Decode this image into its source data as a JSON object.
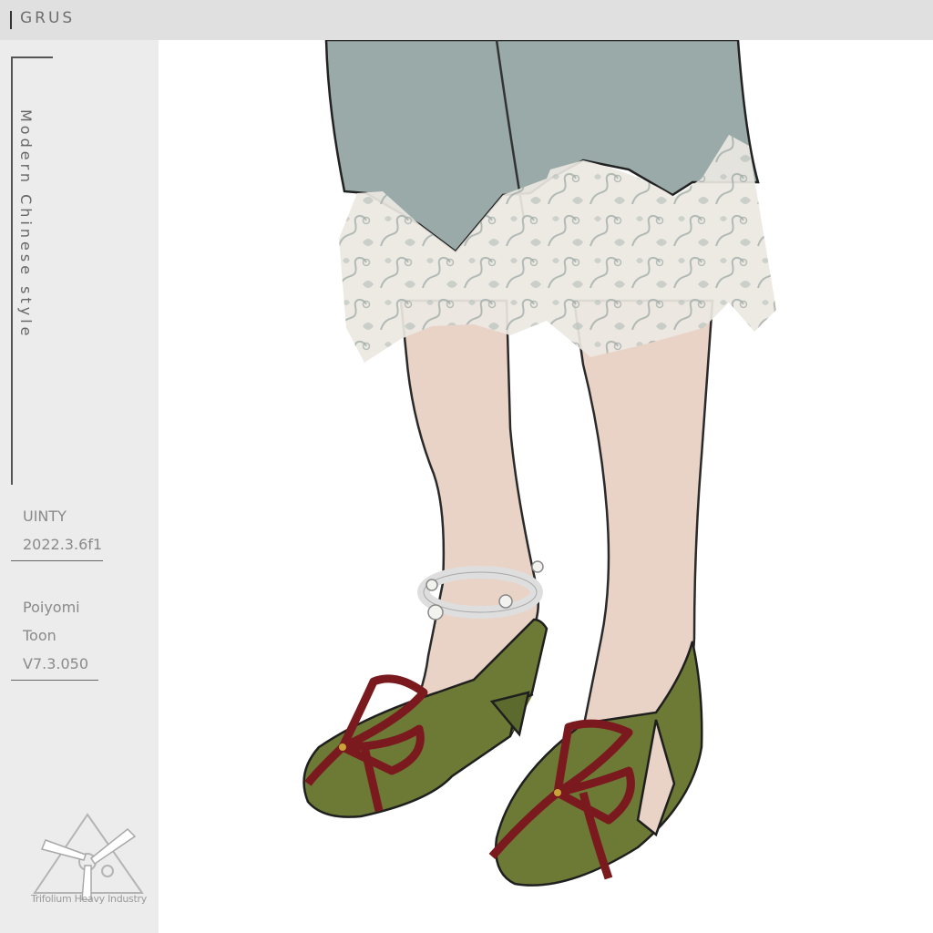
{
  "header": {
    "brand": "GRUS"
  },
  "sidebar": {
    "style_label": "Modern Chinese style",
    "engine_name": "UINTY",
    "engine_version": "2022.3.6f1",
    "shader_line1": "Poiyomi",
    "shader_line2": "Toon",
    "shader_version": "V7.3.050"
  },
  "logo": {
    "company": "Trifolium Heavy Industry",
    "icon": "trifolium-logo-icon"
  },
  "colors": {
    "topbar": "#e0e0e0",
    "sidebar": "#ececec",
    "skirt": "#99aaa8",
    "lace": "#ece8e2",
    "skin": "#e9d2c6",
    "shoe": "#6d7a36",
    "ribbon": "#7a1a1e",
    "anklet": "#f2f2ee"
  }
}
